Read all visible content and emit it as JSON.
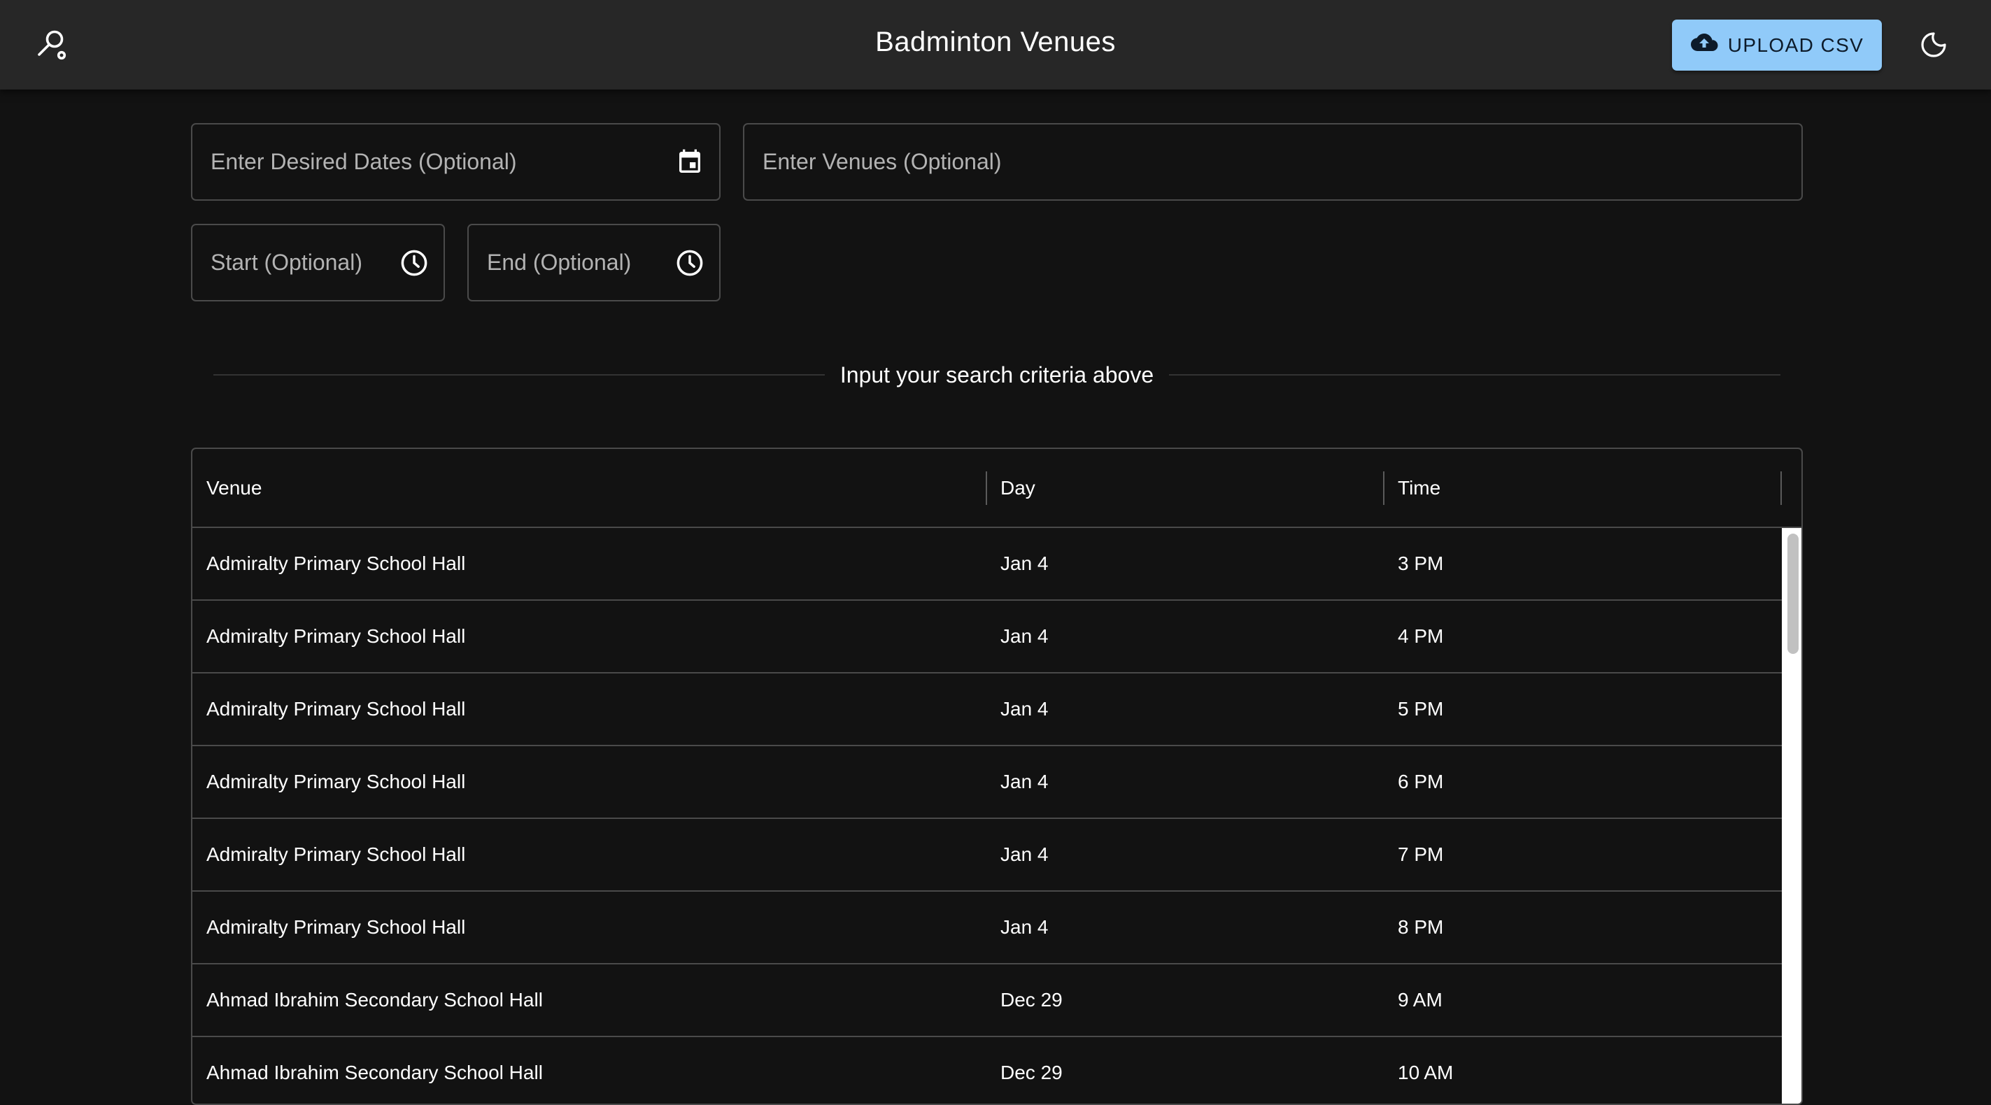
{
  "app": {
    "title": "Badminton Venues",
    "upload_label": "UPLOAD CSV"
  },
  "search": {
    "dates_placeholder": "Enter Desired Dates (Optional)",
    "venues_placeholder": "Enter Venues (Optional)",
    "start_placeholder": "Start (Optional)",
    "end_placeholder": "End (Optional)"
  },
  "divider_text": "Input your search criteria above",
  "table": {
    "columns": [
      "Venue",
      "Day",
      "Time"
    ],
    "rows": [
      [
        "Admiralty Primary School Hall",
        "Jan 4",
        "3 PM"
      ],
      [
        "Admiralty Primary School Hall",
        "Jan 4",
        "4 PM"
      ],
      [
        "Admiralty Primary School Hall",
        "Jan 4",
        "5 PM"
      ],
      [
        "Admiralty Primary School Hall",
        "Jan 4",
        "6 PM"
      ],
      [
        "Admiralty Primary School Hall",
        "Jan 4",
        "7 PM"
      ],
      [
        "Admiralty Primary School Hall",
        "Jan 4",
        "8 PM"
      ],
      [
        "Ahmad Ibrahim Secondary School Hall",
        "Dec 29",
        "9 AM"
      ],
      [
        "Ahmad Ibrahim Secondary School Hall",
        "Dec 29",
        "10 AM"
      ]
    ]
  },
  "icons": {
    "logo": "badminton-racket-icon",
    "upload": "cloud-upload-icon",
    "theme": "moon-icon",
    "calendar": "calendar-icon",
    "clock": "clock-icon"
  },
  "colors": {
    "background": "#121212",
    "appbar": "#272727",
    "accent": "#90caf9",
    "border": "#4a4a4a"
  }
}
